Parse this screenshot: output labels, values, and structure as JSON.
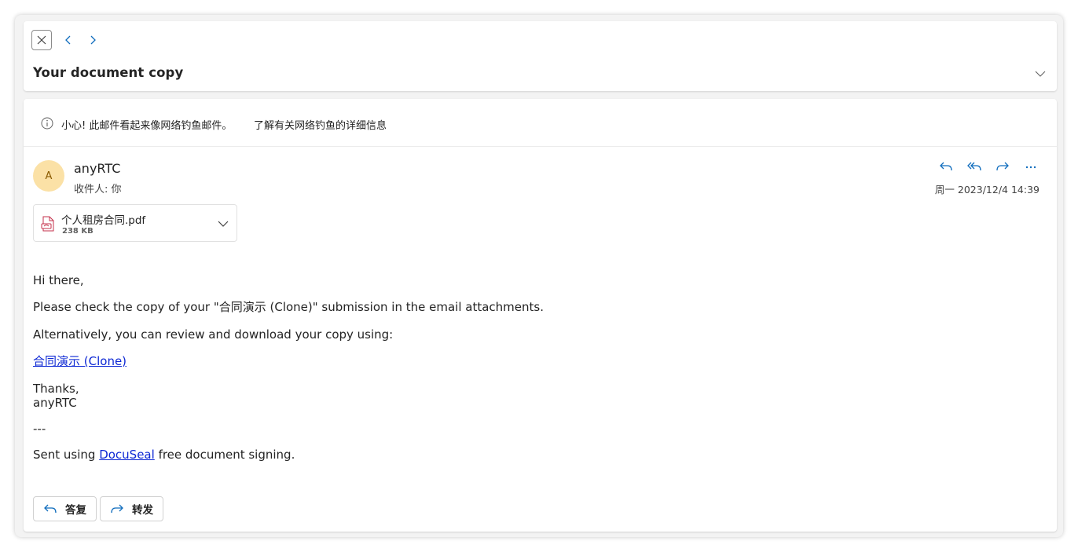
{
  "header": {
    "subject": "Your document copy",
    "icons": [
      "close-icon",
      "chevron-left-icon",
      "chevron-right-icon",
      "chevron-down-icon"
    ]
  },
  "warning": {
    "text": "小心! 此邮件看起来像网络钓鱼邮件。",
    "link": "了解有关网络钓鱼的详细信息",
    "icon": "info-icon"
  },
  "message": {
    "avatar_initial": "A",
    "avatar_color": "#fbe1a6",
    "sender": "anyRTC",
    "recipient": "收件人: 你",
    "timestamp": "周一 2023/12/4 14:39",
    "action_icons": [
      "reply-icon",
      "reply-all-icon",
      "forward-icon",
      "more-icon"
    ],
    "accent_color": "#0f6cbd"
  },
  "attachment": {
    "name": "个人租房合同.pdf",
    "size": "238 KB",
    "icon": "pdf-file-icon"
  },
  "body": {
    "greeting": "Hi there,",
    "line1": "Please check the copy of your \"合同演示 (Clone)\" submission in the email attachments.",
    "line2": "Alternatively, you can review and download your copy using:",
    "link": "合同演示 (Clone)",
    "thanks": "Thanks,",
    "signature": "anyRTC",
    "separator": "---",
    "footer_prefix": "Sent using ",
    "footer_link": "DocuSeal",
    "footer_suffix": " free document signing."
  },
  "reply_buttons": {
    "reply": "答复",
    "forward": "转发"
  }
}
